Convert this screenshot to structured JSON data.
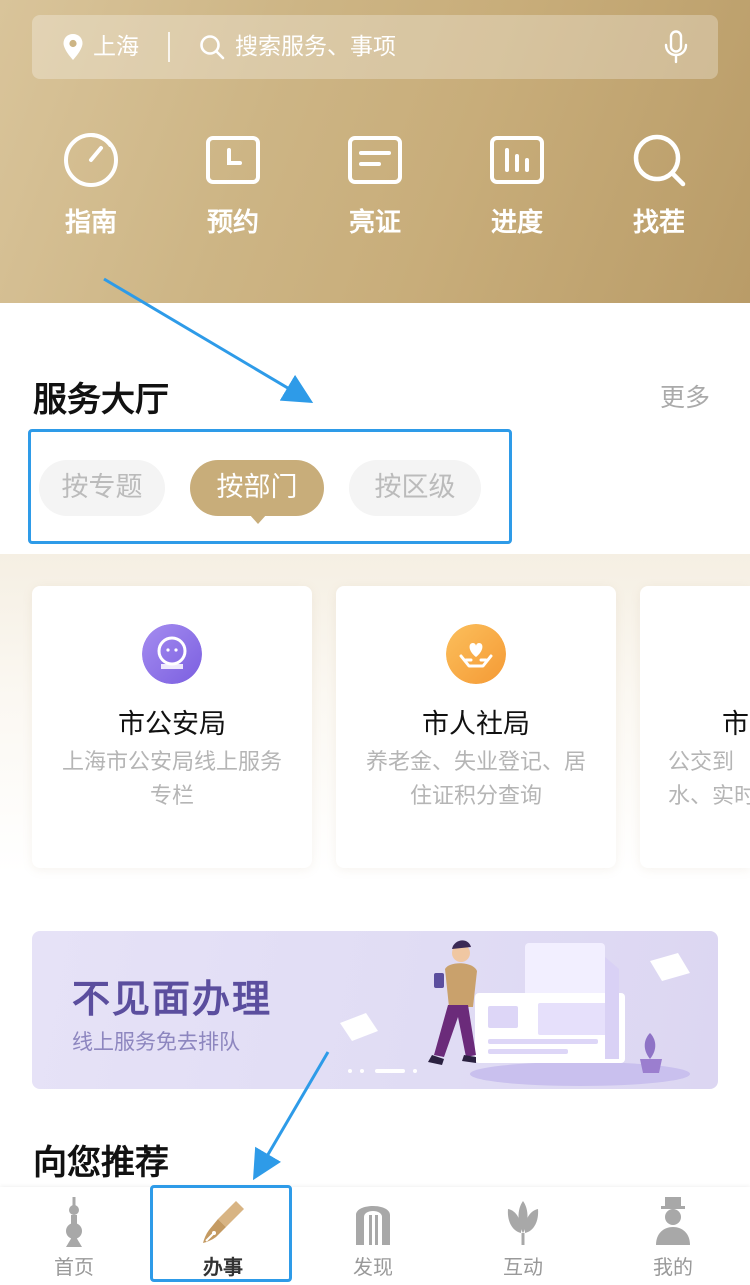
{
  "header": {
    "location": "上海",
    "search_placeholder": "搜索服务、事项"
  },
  "quick_actions": [
    {
      "label": "指南",
      "icon": "gauge-icon"
    },
    {
      "label": "预约",
      "icon": "calendar-icon"
    },
    {
      "label": "亮证",
      "icon": "id-card-icon"
    },
    {
      "label": "进度",
      "icon": "bar-chart-icon"
    },
    {
      "label": "找茬",
      "icon": "magnifier-icon"
    }
  ],
  "service_hall": {
    "title": "服务大厅",
    "more": "更多",
    "filters": [
      "按专题",
      "按部门",
      "按区级"
    ],
    "active_filter": "按部门",
    "cards": [
      {
        "title": "市公安局",
        "desc": "上海市公安局线上服务专栏",
        "icon": "police-badge-icon",
        "color": "#8f74e6"
      },
      {
        "title": "市人社局",
        "desc": "养老金、失业登记、居住证积分查询",
        "icon": "heart-hands-icon",
        "color": "#f7a846"
      },
      {
        "title": "市",
        "desc": "公交到水、实时",
        "icon": "",
        "color": ""
      }
    ]
  },
  "banner": {
    "title": "不见面办理",
    "subtitle": "线上服务免去排队"
  },
  "recommend": {
    "title": "向您推荐"
  },
  "tabbar": {
    "items": [
      {
        "label": "首页",
        "icon": "oriental-pearl-tower-icon"
      },
      {
        "label": "办事",
        "icon": "fountain-pen-icon"
      },
      {
        "label": "发现",
        "icon": "arch-gate-icon"
      },
      {
        "label": "互动",
        "icon": "magnolia-icon"
      },
      {
        "label": "我的",
        "icon": "user-icon"
      }
    ],
    "active": "办事"
  },
  "colors": {
    "gold": "#c8ad7a",
    "highlight_blue": "#2e9be8",
    "banner_purple": "#5b4e9e"
  }
}
